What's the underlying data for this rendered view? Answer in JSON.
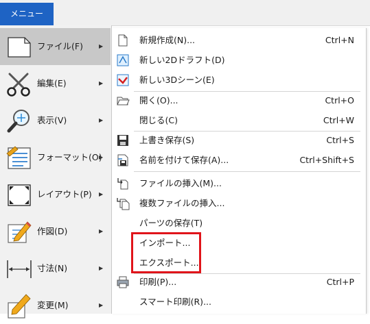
{
  "menubar": {
    "menu_label": "メニュー"
  },
  "left_menu": [
    {
      "label": "ファイル(F)",
      "icon": "file-icon",
      "active": true
    },
    {
      "label": "編集(E)",
      "icon": "scissors-icon"
    },
    {
      "label": "表示(V)",
      "icon": "magnifier-icon"
    },
    {
      "label": "フォーマット(O)",
      "icon": "format-icon"
    },
    {
      "label": "レイアウト(P)",
      "icon": "layout-frame-icon"
    },
    {
      "label": "作図(D)",
      "icon": "drawing-pencil-icon"
    },
    {
      "label": "寸法(N)",
      "icon": "dimension-icon"
    },
    {
      "label": "変更(M)",
      "icon": "modify-pencil-icon"
    }
  ],
  "submenu": [
    {
      "label": "新規作成(N)...",
      "shortcut": "Ctrl+N",
      "icon": "new-document-icon"
    },
    {
      "label": "新しい2Dドラフト(D)",
      "shortcut": "",
      "icon": "new-2d-draft-icon"
    },
    {
      "label": "新しい3Dシーン(E)",
      "shortcut": "",
      "icon": "new-3d-scene-icon"
    },
    {
      "label": "開く(O)...",
      "shortcut": "Ctrl+O",
      "icon": "open-folder-icon"
    },
    {
      "label": "閉じる(C)",
      "shortcut": "Ctrl+W",
      "icon": ""
    },
    {
      "label": "上書き保存(S)",
      "shortcut": "Ctrl+S",
      "icon": "save-icon"
    },
    {
      "label": "名前を付けて保存(A)...",
      "shortcut": "Ctrl+Shift+S",
      "icon": "save-as-icon"
    },
    {
      "label": "ファイルの挿入(M)...",
      "shortcut": "",
      "icon": "insert-file-icon"
    },
    {
      "label": "複数ファイルの挿入...",
      "shortcut": "",
      "icon": "insert-multiple-files-icon"
    },
    {
      "label": "パーツの保存(T)",
      "shortcut": "",
      "icon": ""
    },
    {
      "label": "インポート...",
      "shortcut": "",
      "icon": ""
    },
    {
      "label": "エクスポート...",
      "shortcut": "",
      "icon": ""
    },
    {
      "label": "印刷(P)...",
      "shortcut": "Ctrl+P",
      "icon": "printer-icon"
    },
    {
      "label": "スマート印刷(R)...",
      "shortcut": "",
      "icon": ""
    }
  ],
  "colors": {
    "menu_button": "#1e63c4",
    "highlight_box": "#e0141a",
    "active_item": "#c8c8c8"
  }
}
